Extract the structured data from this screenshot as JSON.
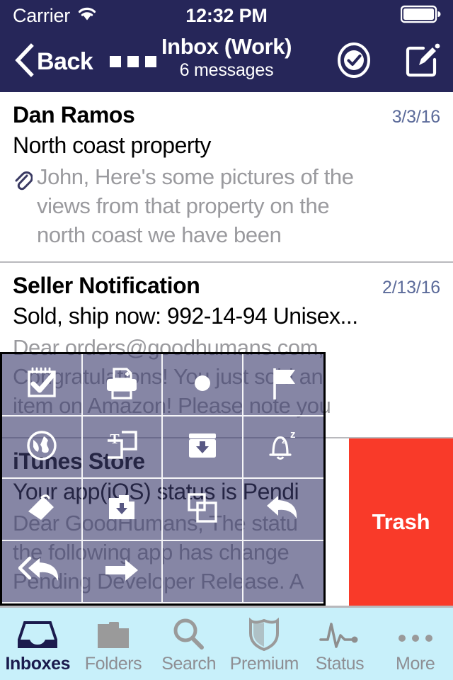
{
  "status_bar": {
    "carrier": "Carrier",
    "wifi_icon": "wifi-icon",
    "time": "12:32 PM",
    "battery_icon": "battery-icon"
  },
  "nav_bar": {
    "back_label": "Back",
    "back_icon": "chevron-left-icon",
    "more_icon": "more-dots-icon",
    "title": "Inbox (Work)",
    "subtitle": "6 messages",
    "select_icon": "check-circle-icon",
    "compose_icon": "compose-icon"
  },
  "colors": {
    "navy": "#262659",
    "date_blue": "#5c6b9a",
    "trash_red": "#f93a29",
    "tabbar_cyan": "#c8f0fa",
    "overlay_purple": "rgba(60,60,110,0.62)",
    "preview_gray": "#9a9a9e"
  },
  "messages": [
    {
      "sender": "Dan Ramos",
      "date": "3/3/16",
      "subject": "North coast property",
      "has_attachment": true,
      "attachment_icon": "paperclip-icon",
      "preview_lines": [
        "John, Here's some pictures of the",
        "views from that property on the",
        "north coast we have been"
      ]
    },
    {
      "sender": "Seller Notification",
      "date": "2/13/16",
      "subject": "Sold, ship now: 992-14-94 Unisex...",
      "has_attachment": false,
      "preview_lines": [
        "Dear orders@goodhumans.com,",
        "Congratulations! You just sold an",
        "item on Amazon! Please note you"
      ]
    },
    {
      "sender": "iTunes Store",
      "date": "",
      "subject": "Your app(iOS) status is Pendi",
      "has_attachment": false,
      "preview_lines": [
        "Dear GoodHumans, The statu",
        "the following app has change",
        "Pending Developer Release. A"
      ]
    }
  ],
  "swipe_action": {
    "label": "Trash",
    "name": "trash-swipe-action"
  },
  "action_grid": {
    "cells": [
      {
        "icon": "notepad-check-icon",
        "label": "mark-as-task"
      },
      {
        "icon": "printer-icon",
        "label": "print"
      },
      {
        "icon": "mark-unread-dot-icon",
        "label": "mark-unread"
      },
      {
        "icon": "flag-icon",
        "label": "flag"
      },
      {
        "icon": "globe-icon",
        "label": "open-in-browser"
      },
      {
        "icon": "text-box-icon",
        "label": "plain-text"
      },
      {
        "icon": "archive-down-icon",
        "label": "archive"
      },
      {
        "icon": "snooze-bell-icon",
        "label": "snooze"
      },
      {
        "icon": "tag-icon",
        "label": "label"
      },
      {
        "icon": "folder-move-icon",
        "label": "move-to-folder"
      },
      {
        "icon": "copy-icon",
        "label": "duplicate"
      },
      {
        "icon": "reply-icon",
        "label": "reply"
      },
      {
        "icon": "reply-all-icon",
        "label": "reply-all"
      },
      {
        "icon": "forward-arrow-icon",
        "label": "forward"
      },
      {
        "icon": "",
        "label": "empty"
      },
      {
        "icon": "",
        "label": "empty"
      }
    ]
  },
  "tab_bar": {
    "tabs": [
      {
        "label": "Inboxes",
        "icon": "inbox-icon",
        "active": true
      },
      {
        "label": "Folders",
        "icon": "folder-icon",
        "active": false
      },
      {
        "label": "Search",
        "icon": "search-icon",
        "active": false
      },
      {
        "label": "Premium",
        "icon": "shield-icon",
        "active": false
      },
      {
        "label": "Status",
        "icon": "pulse-icon",
        "active": false
      },
      {
        "label": "More",
        "icon": "ellipsis-icon",
        "active": false
      }
    ]
  }
}
